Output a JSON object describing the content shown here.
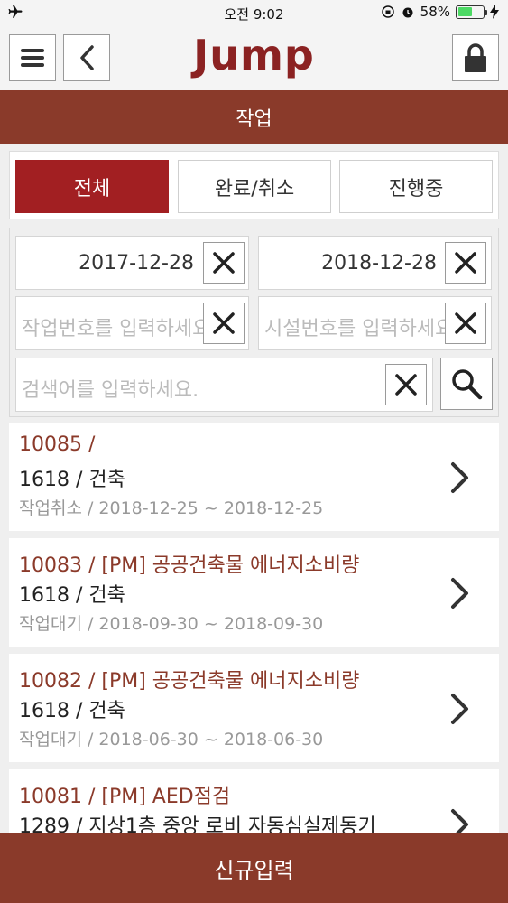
{
  "status_bar": {
    "time": "오전 9:02",
    "battery": "58%",
    "battery_level": 0.58
  },
  "header": {
    "logo": "Jump",
    "section_title": "작업"
  },
  "tabs": [
    {
      "label": "전체",
      "active": true
    },
    {
      "label": "완료/취소",
      "active": false
    },
    {
      "label": "진행중",
      "active": false
    }
  ],
  "filters": {
    "start_date": "2017-12-28",
    "end_date": "2018-12-28",
    "job_number_placeholder": "작업번호를 입력하세요.",
    "facility_number_placeholder": "시설번호를 입력하세요.",
    "keyword_placeholder": "검색어를 입력하세요."
  },
  "jobs": [
    {
      "title": "10085 /",
      "sub": "1618 / 건축",
      "meta": "작업취소 / 2018-12-25 ~ 2018-12-25"
    },
    {
      "title": "10083 / [PM] 공공건축물 에너지소비량",
      "sub": "1618 / 건축",
      "meta": "작업대기 / 2018-09-30 ~ 2018-09-30"
    },
    {
      "title": "10082 / [PM] 공공건축물 에너지소비량",
      "sub": "1618 / 건축",
      "meta": "작업대기 / 2018-06-30 ~ 2018-06-30"
    },
    {
      "title": "10081 / [PM] AED점검",
      "sub": "1289 / 지상1층 중앙 로비 자동심실제동기",
      "meta": ""
    }
  ],
  "bottom_button": "신규입력",
  "colors": {
    "brand": "#8a3a2a",
    "active_tab": "#a21f22",
    "title_text": "#8b3a2a"
  }
}
